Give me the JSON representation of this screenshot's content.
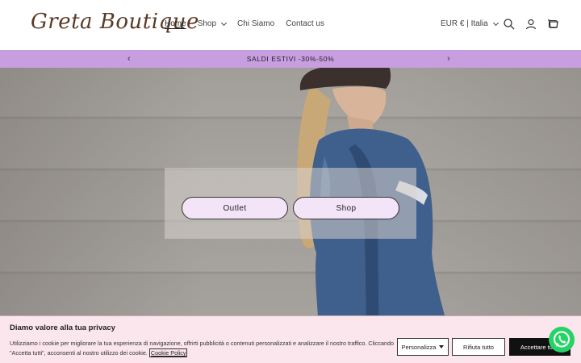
{
  "header": {
    "logo_text": "Greta Boutique",
    "nav": [
      {
        "label": "Home",
        "active": true
      },
      {
        "label": "Shop",
        "has_dropdown": true
      },
      {
        "label": "Chi Siamo"
      },
      {
        "label": "Contact us"
      }
    ],
    "locale_label": "EUR € | Italia",
    "icons": [
      "search-icon",
      "account-icon",
      "cart-icon"
    ]
  },
  "announcement": {
    "text": "SALDI ESTIVI -30%-50%",
    "prev_icon": "chevron-left-icon",
    "next_icon": "chevron-right-icon",
    "background": "#c79ee0"
  },
  "hero": {
    "buttons": [
      {
        "label": "Outlet"
      },
      {
        "label": "Shop"
      }
    ],
    "button_background": "#f3e4f8"
  },
  "cookie_banner": {
    "title": "Diamo valore alla tua privacy",
    "body": "Utilizziamo i cookie per migliorare la tua esperienza di navigazione, offrirti pubblicità o contenuti personalizzati e analizzare il nostro traffico. Cliccando \"Accetta tutti\", acconsenti al nostro utilizzo dei cookie.",
    "link_text": "Cookie Policy",
    "buttons": {
      "customize": "Personalizza",
      "reject": "Rifiuta tutto",
      "accept": "Accettare tutto"
    },
    "background": "#fbe6ee"
  },
  "whatsapp_icon": "whatsapp-icon"
}
